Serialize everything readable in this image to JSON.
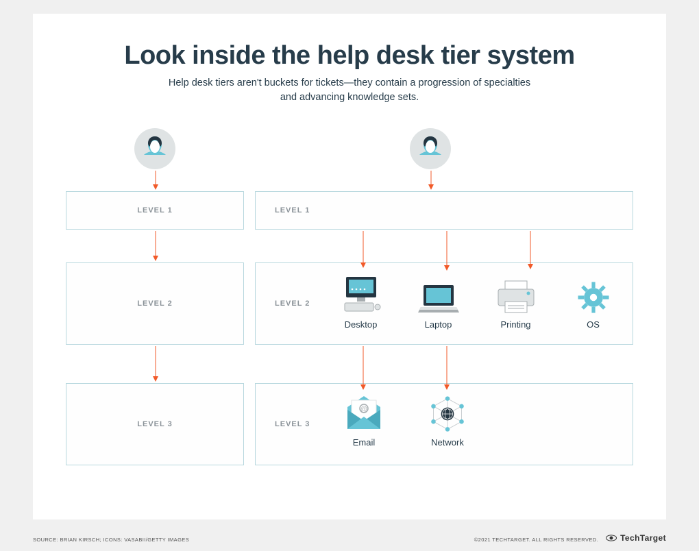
{
  "title": "Look inside the help desk tier system",
  "subtitle_line1": "Help desk tiers aren't buckets for tickets—they contain a progression of specialties",
  "subtitle_line2": "and advancing knowledge sets.",
  "left": {
    "level1": "LEVEL 1",
    "level2": "LEVEL 2",
    "level3": "LEVEL 3"
  },
  "right": {
    "level1": "LEVEL 1",
    "level2": "LEVEL 2",
    "level3": "LEVEL 3",
    "level2_items": [
      "Desktop",
      "Laptop",
      "Printing",
      "OS"
    ],
    "level3_items": [
      "Email",
      "Network"
    ]
  },
  "footer": {
    "source": "SOURCE: BRIAN KIRSCH; ICONS: VASABII/GETTY IMAGES",
    "copyright": "©2021 TECHTARGET. ALL RIGHTS RESERVED.",
    "logo_text": "TechTarget"
  }
}
